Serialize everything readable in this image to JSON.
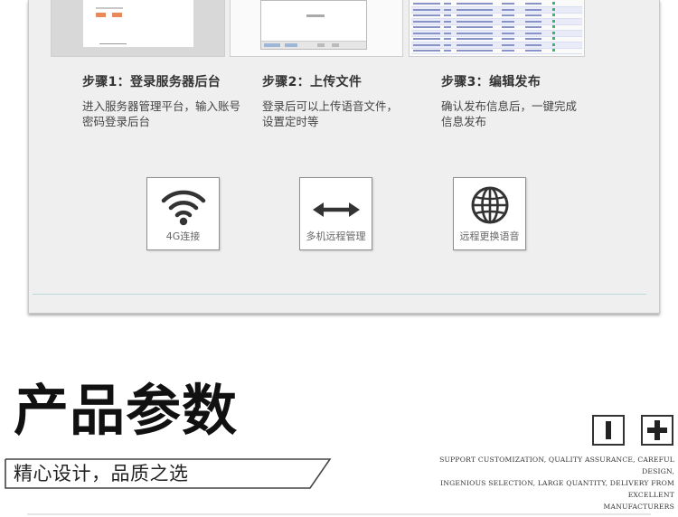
{
  "steps": [
    {
      "title": "步骤1：登录服务器后台",
      "desc_lines": [
        "进入服务器管理平台，输入账号",
        "密码登录后台"
      ]
    },
    {
      "title": "步骤2：上传文件",
      "desc_lines": [
        "登录后可以上传语音文件，",
        "设置定时等"
      ]
    },
    {
      "title": "步骤3：编辑发布",
      "desc_lines": [
        "确认发布信息后，一键完成",
        "信息发布"
      ]
    }
  ],
  "features": [
    {
      "label": "4G连接",
      "icon": "wifi-icon"
    },
    {
      "label": "多机远程管理",
      "icon": "double-arrow-icon"
    },
    {
      "label": "远程更换语音",
      "icon": "globe-icon"
    }
  ],
  "section": {
    "title": "产品参数",
    "slogan": "精心设计，品质之选",
    "english_lines": [
      "SUPPORT CUSTOMIZATION, QUALITY ASSURANCE, CAREFUL DESIGN,",
      "INGENIOUS SELECTION, LARGE QUANTITY, DELIVERY FROM EXCELLENT",
      "MANUFACTURERS"
    ],
    "icons": [
      "bar-icon",
      "plus-icon"
    ]
  },
  "colors": {
    "panel_bg": "#efefef",
    "accent_orange": "#e8895b",
    "text_dark": "#111111"
  }
}
